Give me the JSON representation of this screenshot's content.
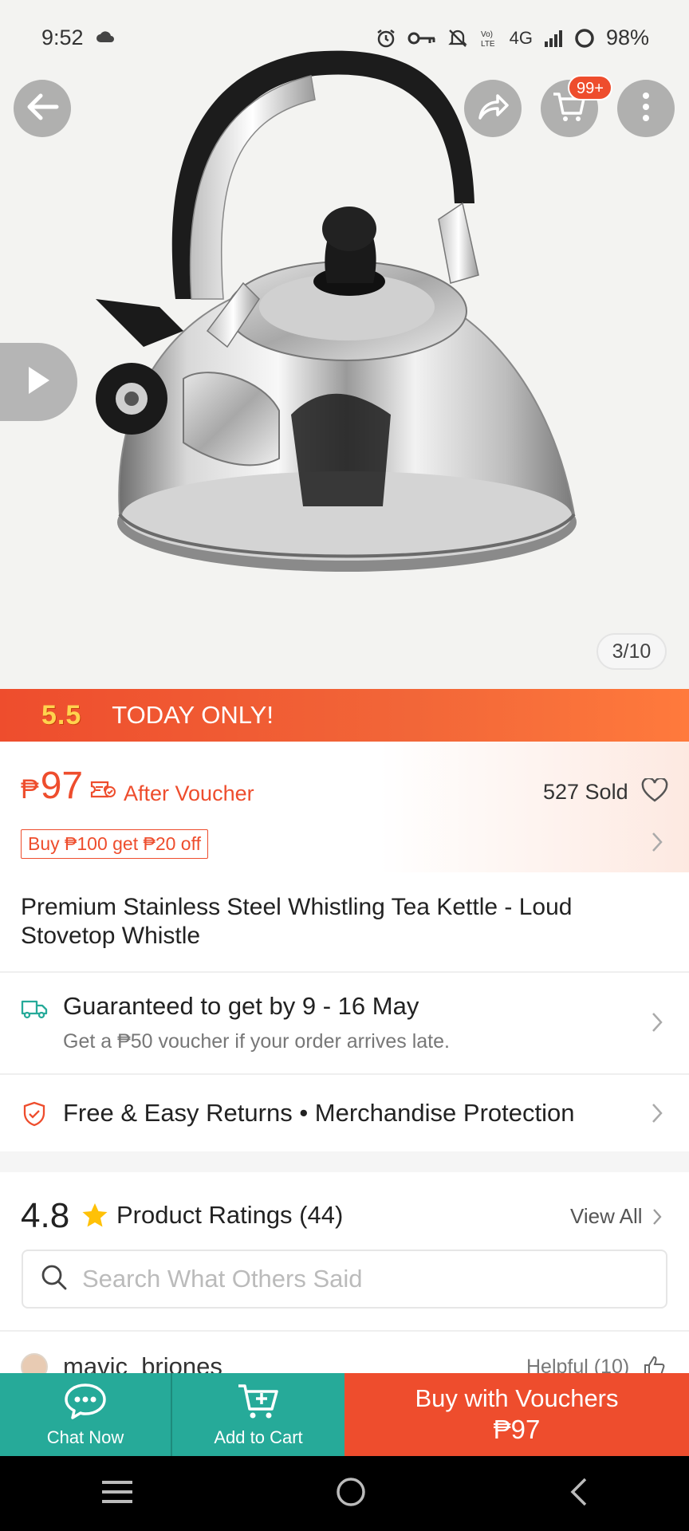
{
  "status_bar": {
    "time": "9:52",
    "network": "4G",
    "battery": "98%",
    "icons": [
      "cloud-icon",
      "alarm-icon",
      "key-icon",
      "mute-icon",
      "volte-icon",
      "signal-icon",
      "battery-icon"
    ]
  },
  "hero": {
    "cart_badge": "99+",
    "image_counter": "3/10"
  },
  "promo": {
    "tag": "5.5",
    "text": "TODAY ONLY!",
    "color": "#ee4d2d"
  },
  "price": {
    "currency": "₱",
    "amount": "97",
    "after_voucher": "After Voucher",
    "sold": "527 Sold",
    "deal": "Buy ₱100 get ₱20 off"
  },
  "product": {
    "title": "Premium Stainless Steel Whistling Tea Kettle - Loud Stovetop Whistle"
  },
  "shipping": {
    "title": "Guaranteed to get by 9 - 16 May",
    "subtitle": "Get a ₱50 voucher if your order arrives late."
  },
  "returns": {
    "text": "Free & Easy Returns  •  Merchandise Protection"
  },
  "ratings": {
    "score": "4.8",
    "label": "Product Ratings (44)",
    "view_all": "View All",
    "search_placeholder": "Search What Others Said"
  },
  "review": {
    "user": "mavic_briones",
    "helpful": "Helpful (10)"
  },
  "actions": {
    "chat_label": "Chat Now",
    "cart_label": "Add to Cart",
    "buy_label": "Buy with Vouchers",
    "buy_price": "₱97",
    "accent": "#26aa99"
  }
}
